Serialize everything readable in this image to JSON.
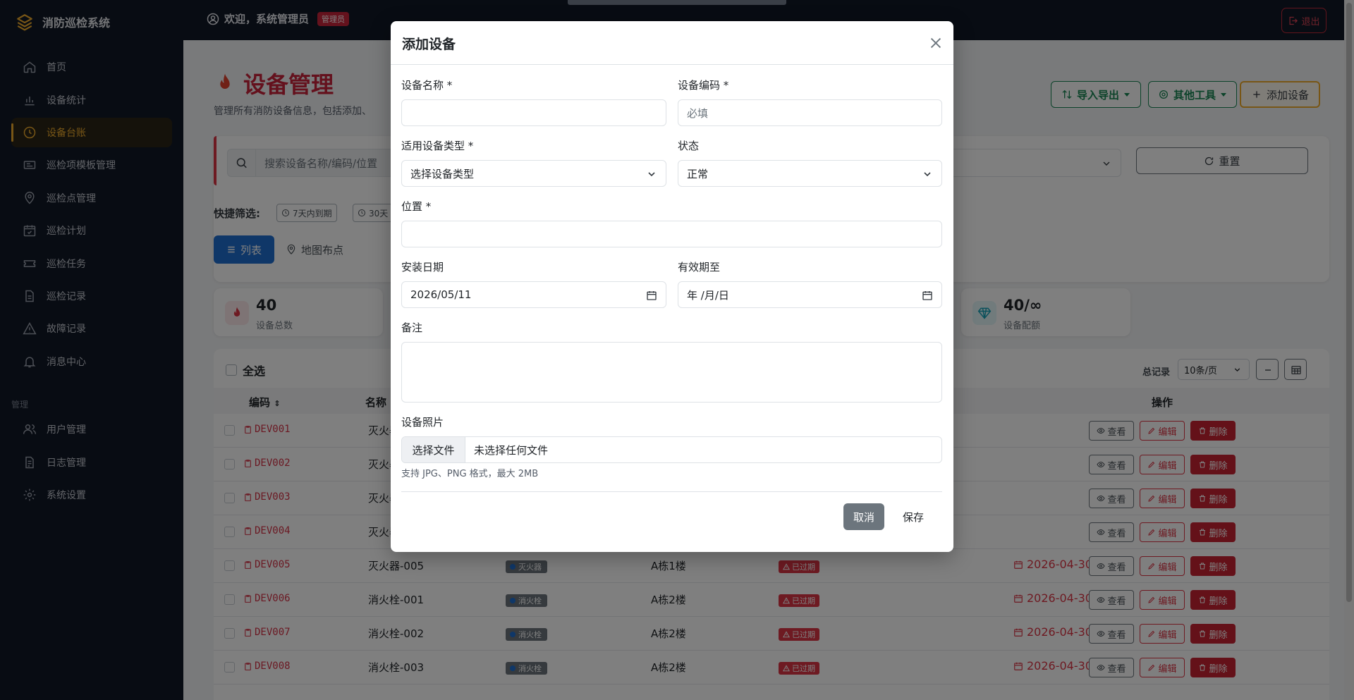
{
  "app": {
    "title": "消防巡检系统"
  },
  "sidebar": {
    "items": [
      {
        "label": "首页",
        "icon": "house-icon"
      },
      {
        "label": "设备统计",
        "icon": "bar-chart-icon"
      },
      {
        "label": "设备台账",
        "icon": "clock-icon",
        "active": true
      },
      {
        "label": "巡检项模板管理",
        "icon": "template-icon"
      },
      {
        "label": "巡检点管理",
        "icon": "map-pin-icon"
      },
      {
        "label": "巡检计划",
        "icon": "calendar-check-icon"
      },
      {
        "label": "巡检任务",
        "icon": "ticket-icon"
      },
      {
        "label": "巡检记录",
        "icon": "document-icon"
      },
      {
        "label": "故障记录",
        "icon": "warning-icon"
      },
      {
        "label": "消息中心",
        "icon": "bell-icon"
      }
    ],
    "section_label": "管理",
    "admin_items": [
      {
        "label": "用户管理",
        "icon": "users-icon"
      },
      {
        "label": "日志管理",
        "icon": "log-icon"
      },
      {
        "label": "系统设置",
        "icon": "gear-icon"
      }
    ],
    "accent_color": "#f0ad2c"
  },
  "topbar": {
    "welcome": "欢迎，系统管理员",
    "role": "管理员",
    "logout": "退出"
  },
  "page": {
    "title": "设备管理",
    "description": "管理所有消防设备信息，包括添加、",
    "toolbar": {
      "import_export": "导入导出",
      "tools": "其他工具",
      "add": "添加设备"
    },
    "search_placeholder": "搜索设备名称/编码/位置",
    "reset": "重置",
    "quick_filter_label": "快捷筛选:",
    "quick_filters": [
      "7天内到期",
      "30天"
    ],
    "view_list": "列表",
    "view_map": "地图布点"
  },
  "stats": [
    {
      "value": "40",
      "label": "设备总数",
      "icon": "fire-icon",
      "color": "#dc3545"
    },
    {
      "value": "40/∞",
      "label": "设备配额",
      "icon": "gem-icon",
      "color": "#17a2b8"
    }
  ],
  "list": {
    "select_all": "全选",
    "total_label": "总记录",
    "page_size": "10条/页",
    "columns": {
      "code": "编码",
      "name": "名称",
      "actions": "操作"
    },
    "actions": {
      "view": "查看",
      "edit": "编辑",
      "delete": "删除"
    },
    "rows": [
      {
        "code": "DEV001",
        "name": "灭火器",
        "type": "",
        "location": "",
        "status": "",
        "expiry": ""
      },
      {
        "code": "DEV002",
        "name": "灭火器",
        "type": "",
        "location": "",
        "status": "",
        "expiry": ""
      },
      {
        "code": "DEV003",
        "name": "灭火器",
        "type": "",
        "location": "",
        "status": "",
        "expiry": ""
      },
      {
        "code": "DEV004",
        "name": "灭火器",
        "type": "",
        "location": "",
        "status": "",
        "expiry": ""
      },
      {
        "code": "DEV005",
        "name": "灭火器-005",
        "type": "灭火器",
        "location": "A栋1楼",
        "status": "已过期",
        "expiry": "2026-04-30"
      },
      {
        "code": "DEV006",
        "name": "消火栓-001",
        "type": "消火栓",
        "location": "A栋2楼",
        "status": "已过期",
        "expiry": "2026-04-30"
      },
      {
        "code": "DEV007",
        "name": "消火栓-002",
        "type": "消火栓",
        "location": "A栋2楼",
        "status": "已过期",
        "expiry": "2026-04-30"
      },
      {
        "code": "DEV008",
        "name": "消火栓-003",
        "type": "消火栓",
        "location": "A栋2楼",
        "status": "已过期",
        "expiry": "2026-04-30"
      }
    ]
  },
  "modal": {
    "title": "添加设备",
    "fields": {
      "name": {
        "label": "设备名称 *",
        "value": ""
      },
      "code": {
        "label": "设备编码 *",
        "placeholder": "必填"
      },
      "type": {
        "label": "适用设备类型 *",
        "value": "选择设备类型"
      },
      "status": {
        "label": "状态",
        "value": "正常"
      },
      "location": {
        "label": "位置 *",
        "value": ""
      },
      "install_date": {
        "label": "安装日期",
        "value": "2026/05/11"
      },
      "valid_until": {
        "label": "有效期至",
        "value": "年 /月/日"
      },
      "notes": {
        "label": "备注"
      },
      "photo": {
        "label": "设备照片",
        "button": "选择文件",
        "value": "未选择任何文件",
        "hint": "支持 JPG、PNG 格式，最大 2MB"
      }
    },
    "cancel": "取消",
    "save": "保存"
  }
}
